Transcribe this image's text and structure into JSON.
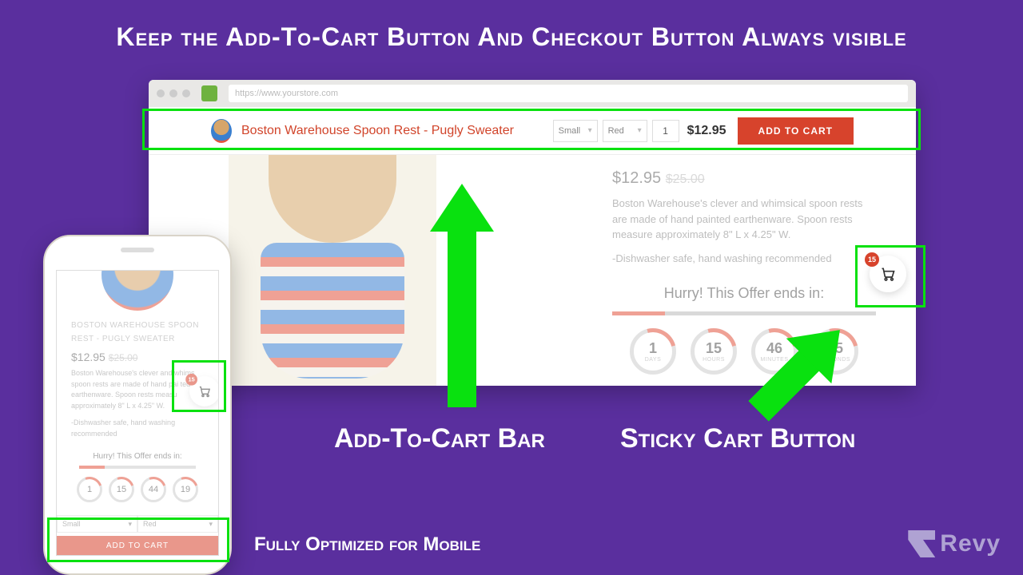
{
  "headline": "Keep the Add-To-Cart Button And Checkout Button Always visible",
  "captions": {
    "atc_bar": "Add-To-Cart Bar",
    "sticky_cart": "Sticky Cart Button",
    "mobile": "Fully Optimized for Mobile"
  },
  "browser": {
    "url": "https://www.yourstore.com"
  },
  "atc_bar": {
    "product_title": "Boston Warehouse Spoon Rest - Pugly Sweater",
    "size_label": "Small",
    "color_label": "Red",
    "qty": "1",
    "price": "$12.95",
    "button": "ADD TO CART"
  },
  "product": {
    "price": "$12.95",
    "compare": "$25.00",
    "desc1": "Boston Warehouse's clever and whimsical spoon rests are made of hand painted earthenware. Spoon rests measure approximately 8\" L x 4.25\" W.",
    "desc2": "-Dishwasher safe, hand washing recommended",
    "hurry": "Hurry! This Offer ends in:",
    "timer": [
      {
        "n": "1",
        "l": "DAYS"
      },
      {
        "n": "15",
        "l": "HOURS"
      },
      {
        "n": "46",
        "l": "MINUTES"
      },
      {
        "n": "35",
        "l": "SECONDS"
      }
    ]
  },
  "sticky_cart": {
    "count": "15"
  },
  "mobile": {
    "title": "BOSTON WAREHOUSE SPOON REST - PUGLY SWEATER",
    "price": "$12.95",
    "compare": "$25.00",
    "desc1": "Boston Warehouse's clever and whims spoon rests are made of hand pai ted earthenware. Spoon rests measu approximately 8\" L x 4.25\" W.",
    "desc2": "-Dishwasher safe, hand washing recommended",
    "hurry": "Hurry! This Offer ends in:",
    "timer": [
      "1",
      "15",
      "44",
      "19"
    ],
    "size": "Small",
    "color": "Red",
    "atc": "ADD TO CART",
    "cart_count": "15"
  },
  "logo": "Revy"
}
